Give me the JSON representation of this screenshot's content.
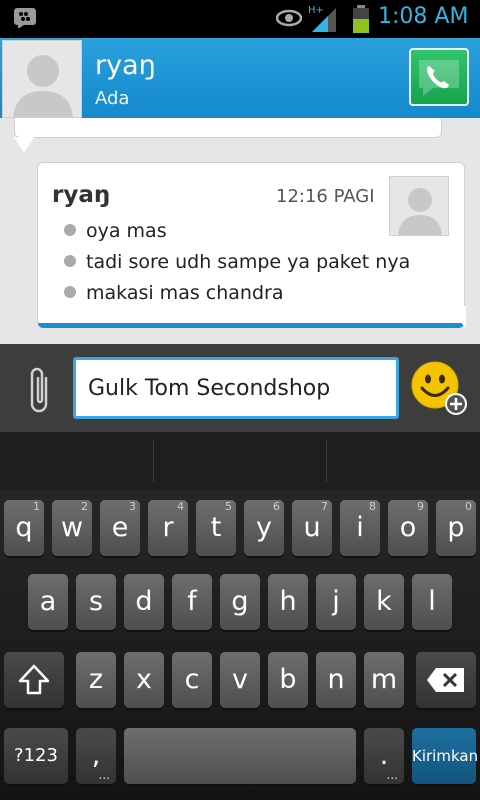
{
  "status_bar": {
    "network": "H+",
    "time": "1:08 AM"
  },
  "header": {
    "contact_name": "ryaŋ",
    "contact_status": "Ada"
  },
  "message": {
    "sender": "ryaŋ",
    "time": "12:16 PAGI",
    "lines": [
      "oya mas",
      "tadi sore udh sampe ya paket nya",
      "makasi mas chandra"
    ]
  },
  "composer": {
    "input_value": "Gulk Tom Secondshop"
  },
  "keyboard": {
    "row1": [
      {
        "label": "q",
        "hint": "1"
      },
      {
        "label": "w",
        "hint": "2"
      },
      {
        "label": "e",
        "hint": "3"
      },
      {
        "label": "r",
        "hint": "4"
      },
      {
        "label": "t",
        "hint": "5"
      },
      {
        "label": "y",
        "hint": "6"
      },
      {
        "label": "u",
        "hint": "7"
      },
      {
        "label": "i",
        "hint": "8"
      },
      {
        "label": "o",
        "hint": "9"
      },
      {
        "label": "p",
        "hint": "0"
      }
    ],
    "row2": [
      "a",
      "s",
      "d",
      "f",
      "g",
      "h",
      "j",
      "k",
      "l"
    ],
    "row3": [
      "z",
      "x",
      "c",
      "v",
      "b",
      "n",
      "m"
    ],
    "symbols_label": "?123",
    "comma_label": ",",
    "period_label": ".",
    "send_label": "Kirimkan",
    "more_dots": "..."
  },
  "colors": {
    "header_blue": "#1a8fd0",
    "time_blue": "#33b5e5",
    "call_green": "#1fae58",
    "emoji_yellow": "#f5c400"
  }
}
